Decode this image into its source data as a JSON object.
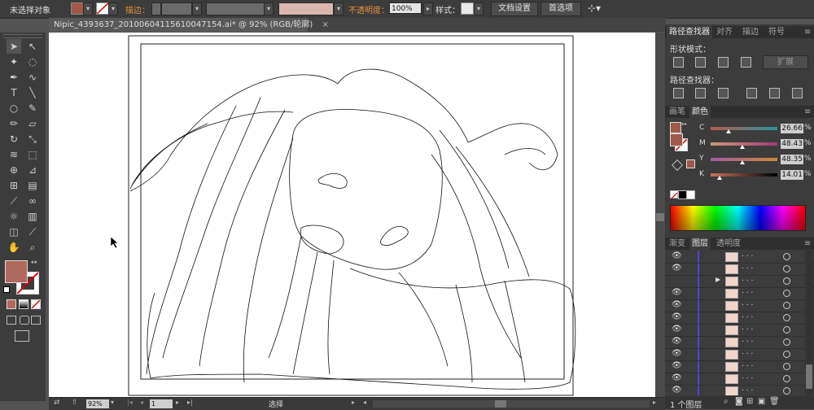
{
  "control_bar": {
    "selection_label": "未选择对象",
    "stroke_label": "描边：",
    "opacity_label": "不透明度：",
    "opacity_value": "100%",
    "style_label": "样式：",
    "doc_setup_button": "文档设置",
    "preferences_button": "首选项",
    "fill_color": "#a0584a"
  },
  "document": {
    "tab_title": "Nipic_4393637_20100604115610047154.ai* @ 92% (RGB/轮廓)",
    "close_glyph": "×"
  },
  "toolbox": {
    "fill_color": "#b06a5c",
    "tools": [
      "selection-tool",
      "direct-selection-tool",
      "magic-wand-tool",
      "lasso-tool",
      "pen-tool",
      "curvature-tool",
      "type-tool",
      "line-tool",
      "ellipse-tool",
      "paintbrush-tool",
      "pencil-tool",
      "eraser-tool",
      "rotate-tool",
      "scale-tool",
      "width-tool",
      "free-transform-tool",
      "shape-builder-tool",
      "perspective-tool",
      "mesh-tool",
      "gradient-tool",
      "eyedropper-tool",
      "blend-tool",
      "symbol-sprayer-tool",
      "column-graph-tool",
      "artboard-tool",
      "slice-tool",
      "hand-tool",
      "zoom-tool"
    ]
  },
  "status_bar": {
    "zoom": "92%",
    "page": "1",
    "mode": "选择"
  },
  "pathfinder_panel": {
    "tabs": [
      "路径查找器",
      "对齐",
      "描边",
      "符号"
    ],
    "shape_modes_label": "形状模式：",
    "expand_button": "扩展",
    "pathfinders_label": "路径查找器："
  },
  "color_panel": {
    "tabs": [
      "画笔",
      "颜色"
    ],
    "fill_color": "#a0584a",
    "stroke_color": "#a0584a",
    "channels": [
      {
        "label": "C",
        "value": "26.66",
        "unit": "%",
        "level": 0.27
      },
      {
        "label": "M",
        "value": "48.43",
        "unit": "%",
        "level": 0.48
      },
      {
        "label": "Y",
        "value": "48.35",
        "unit": "%",
        "level": 0.48
      },
      {
        "label": "K",
        "value": "14.01",
        "unit": "%",
        "level": 0.14
      }
    ]
  },
  "layers_panel": {
    "tabs": [
      "渐变",
      "图层",
      "透明度"
    ],
    "item_label": ". . .",
    "footer": "1 个图层"
  }
}
